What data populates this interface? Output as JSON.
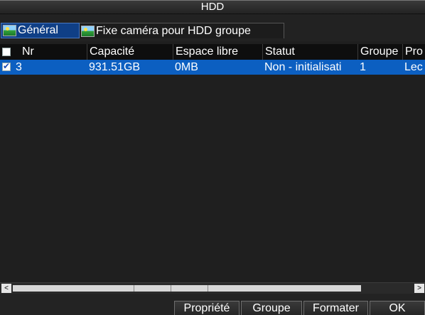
{
  "window": {
    "title": "HDD"
  },
  "tabs": [
    {
      "label": "Général",
      "active": true,
      "icon": "landscape-icon"
    },
    {
      "label": "Fixe caméra pour HDD groupe",
      "active": false,
      "icon": "landscape-icon"
    }
  ],
  "table": {
    "columns": [
      "Nr",
      "Capacité",
      "Espace libre",
      "Statut",
      "Groupe",
      "Pro"
    ],
    "select_all_checked": false,
    "rows": [
      {
        "checked": true,
        "nr": "3",
        "capacite": "931.51GB",
        "espace_libre": "0MB",
        "statut": "Non - initialisati",
        "groupe": "1",
        "pro": "Lec",
        "selected": true
      }
    ]
  },
  "scrollbar": {
    "left_arrow": "<",
    "right_arrow": ">"
  },
  "buttons": {
    "propriete": "Propriété",
    "groupe": "Groupe",
    "formater": "Formater",
    "ok": "OK"
  },
  "colors": {
    "selected_row": "#0c5fc1",
    "active_tab": "#0f3f86",
    "background": "#1f1f1f"
  }
}
